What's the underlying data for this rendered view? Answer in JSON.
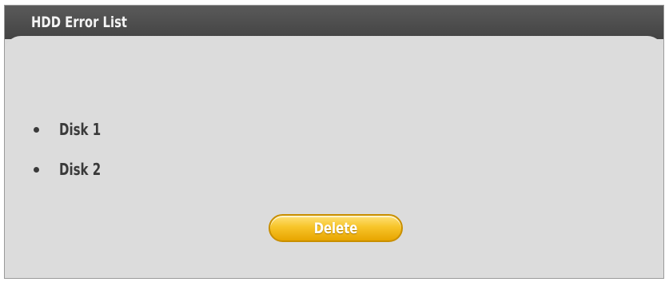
{
  "dialog": {
    "title": "HDD Error List",
    "disks": [
      {
        "label": "Disk 1"
      },
      {
        "label": "Disk 2"
      }
    ],
    "delete_label": "Delete"
  },
  "colors": {
    "title_bar": "#4d4d4d",
    "panel": "#dcdcdc",
    "button": "#f7c52a"
  },
  "icons": {
    "bullet": "bullet-icon"
  }
}
